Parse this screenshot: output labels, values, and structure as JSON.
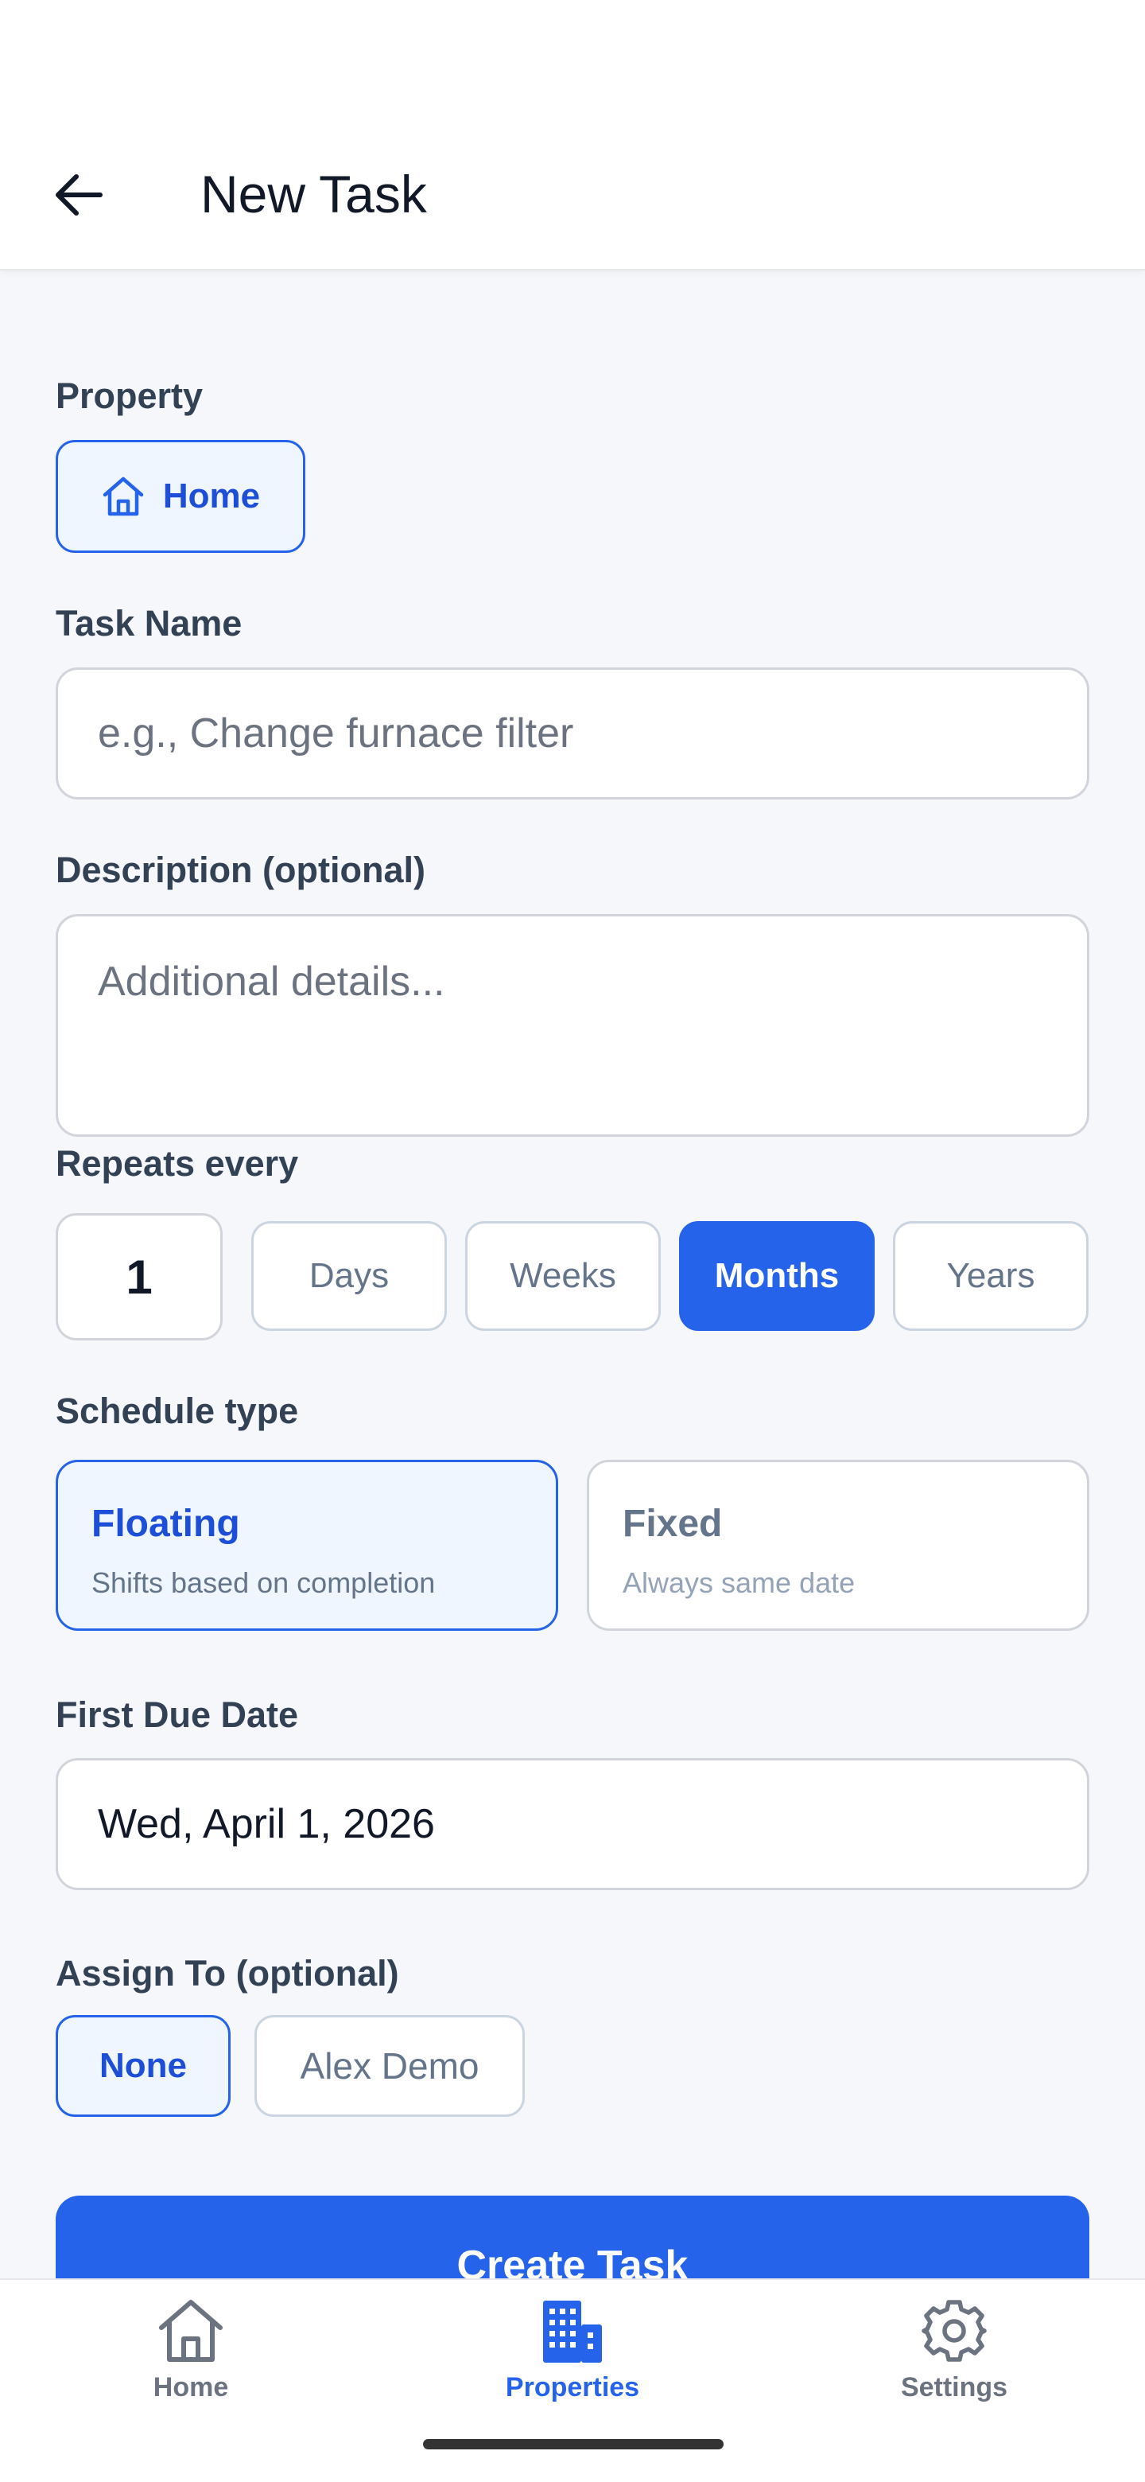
{
  "header": {
    "title": "New Task"
  },
  "property": {
    "label": "Property",
    "options": [
      {
        "label": "Home",
        "icon": "home-outline-icon",
        "selected": true
      }
    ]
  },
  "task_name": {
    "label": "Task Name",
    "placeholder": "e.g., Change furnace filter",
    "value": ""
  },
  "description": {
    "label": "Description (optional)",
    "placeholder": "Additional details...",
    "value": ""
  },
  "repeat": {
    "label": "Repeats every",
    "count": "1",
    "units": [
      {
        "label": "Days",
        "selected": false
      },
      {
        "label": "Weeks",
        "selected": false
      },
      {
        "label": "Months",
        "selected": true
      },
      {
        "label": "Years",
        "selected": false
      }
    ]
  },
  "schedule": {
    "label": "Schedule type",
    "options": [
      {
        "title": "Floating",
        "subtitle": "Shifts based on completion",
        "selected": true
      },
      {
        "title": "Fixed",
        "subtitle": "Always same date",
        "selected": false
      }
    ]
  },
  "due_date": {
    "label": "First Due Date",
    "value": "Wed, April 1, 2026"
  },
  "assign": {
    "label": "Assign To (optional)",
    "options": [
      {
        "label": "None",
        "selected": true
      },
      {
        "label": "Alex Demo",
        "selected": false
      }
    ]
  },
  "submit": {
    "label": "Create Task"
  },
  "nav": {
    "items": [
      {
        "label": "Home",
        "icon": "home-icon",
        "active": false
      },
      {
        "label": "Properties",
        "icon": "building-icon",
        "active": true
      },
      {
        "label": "Settings",
        "icon": "gear-icon",
        "active": false
      }
    ]
  },
  "colors": {
    "accent": "#2563EB",
    "accent_light": "#EFF6FF",
    "background": "#F5F7FA"
  }
}
